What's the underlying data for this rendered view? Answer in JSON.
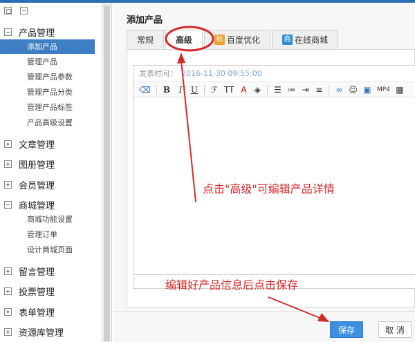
{
  "sidebar": {
    "tools": [
      "expand-all",
      "collapse-all"
    ],
    "groups": [
      {
        "label": "产品管理",
        "expanded": true,
        "items": [
          "添加产品",
          "管理产品",
          "管理产品参数",
          "管理产品分类",
          "管理产品标签",
          "产品高级设置"
        ]
      },
      {
        "label": "文章管理",
        "expanded": false
      },
      {
        "label": "图册管理",
        "expanded": false
      },
      {
        "label": "会员管理",
        "expanded": false
      },
      {
        "label": "商城管理",
        "expanded": true,
        "items": [
          "商城功能设置",
          "管理订单",
          "设计商城页面"
        ]
      },
      {
        "label": "留言管理",
        "expanded": false
      },
      {
        "label": "投票管理",
        "expanded": false
      },
      {
        "label": "表单管理",
        "expanded": false
      },
      {
        "label": "资源库管理",
        "expanded": false
      }
    ]
  },
  "main": {
    "title": "添加产品",
    "tabs": [
      {
        "label": "常规",
        "active": false
      },
      {
        "label": "高级",
        "active": true
      },
      {
        "label": "百度优化",
        "icon_text": "标",
        "active": false
      },
      {
        "label": "在线商城",
        "icon_text": "商",
        "active": false
      }
    ],
    "publish_time_label": "发表时间：",
    "publish_time_value": "2016-11-30 09:55:00",
    "toolbar": {
      "bold": "B",
      "italic": "I",
      "underline": "U",
      "text_size": "TT",
      "font_color": "A",
      "video": "MP4"
    },
    "save_label": "保存",
    "cancel_label": "取 消"
  },
  "annotations": {
    "tip_advanced": "点击\"高级\"可编辑产品详情",
    "tip_save": "编辑好产品信息后点击保存",
    "color": "#d42a2a"
  },
  "colors": {
    "accent": "#3d7ec4",
    "save_button": "#3d8fe0"
  }
}
